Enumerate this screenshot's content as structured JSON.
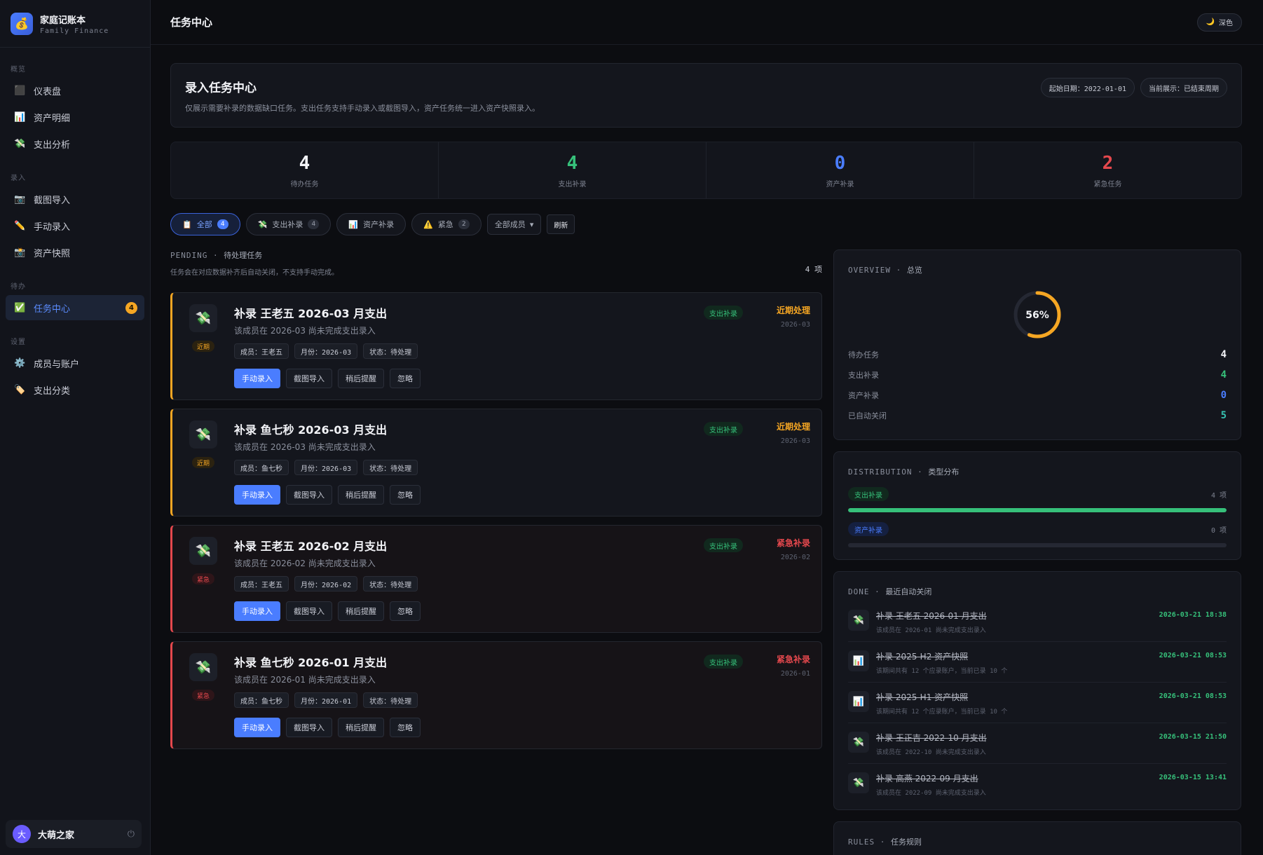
{
  "brand": {
    "title": "家庭记账本",
    "subtitle": "Family Finance",
    "logo": "💰"
  },
  "nav": {
    "sections": [
      {
        "label": "概览",
        "items": [
          {
            "icon": "⬛",
            "label": "仪表盘"
          },
          {
            "icon": "📊",
            "label": "资产明细"
          },
          {
            "icon": "💸",
            "label": "支出分析"
          }
        ]
      },
      {
        "label": "录入",
        "items": [
          {
            "icon": "📷",
            "label": "截图导入"
          },
          {
            "icon": "✏️",
            "label": "手动录入"
          },
          {
            "icon": "📸",
            "label": "资产快照"
          }
        ]
      },
      {
        "label": "待办",
        "items": [
          {
            "icon": "✅",
            "label": "任务中心",
            "badge": "4",
            "active": true
          }
        ]
      },
      {
        "label": "设置",
        "items": [
          {
            "icon": "⚙️",
            "label": "成员与账户"
          },
          {
            "icon": "🏷️",
            "label": "支出分类"
          }
        ]
      }
    ]
  },
  "user": {
    "avatar": "大",
    "name": "大萌之家",
    "power_icon": "⏻"
  },
  "topbar": {
    "title": "任务中心",
    "theme_icon": "🌙",
    "theme_label": "深色"
  },
  "hero": {
    "title": "录入任务中心",
    "desc": "仅展示需要补录的数据缺口任务。支出任务支持手动录入或截图导入，资产任务统一进入资产快照录入。",
    "chip_start": "起始日期：2022-01-01",
    "chip_current": "当前展示：已结束周期"
  },
  "stats": [
    {
      "value": "4",
      "label": "待办任务",
      "color": "#f2f3f7"
    },
    {
      "value": "4",
      "label": "支出补录",
      "color": "#36c07a"
    },
    {
      "value": "0",
      "label": "资产补录",
      "color": "#4a7dff"
    },
    {
      "value": "2",
      "label": "紧急任务",
      "color": "#e5484d"
    }
  ],
  "filters": {
    "all": {
      "icon": "📋",
      "label": "全部",
      "count": "4"
    },
    "expense": {
      "icon": "💸",
      "label": "支出补录",
      "count": "4"
    },
    "asset": {
      "icon": "📊",
      "label": "资产补录"
    },
    "urgent": {
      "icon": "⚠️",
      "label": "紧急",
      "count": "2"
    },
    "member_select": "全部成员",
    "refresh": "刷新"
  },
  "pending": {
    "head_en": "PENDING",
    "head_cn": "待处理任务",
    "sub": "任务会在对应数据补齐后自动关闭，不支持手动完成。",
    "count": "4 项"
  },
  "tasks": [
    {
      "level": "near",
      "tag": "近期",
      "icon": "💸",
      "title": "补录 王老五 2026-03 月支出",
      "desc": "该成员在 2026-03 尚未完成支出录入",
      "meta_member": "成员：王老五",
      "meta_month": "月份：2026-03",
      "meta_status": "状态：待处理",
      "type": "支出补录",
      "status": "近期处理",
      "month": "2026-03"
    },
    {
      "level": "near",
      "tag": "近期",
      "icon": "💸",
      "title": "补录 鱼七秒 2026-03 月支出",
      "desc": "该成员在 2026-03 尚未完成支出录入",
      "meta_member": "成员：鱼七秒",
      "meta_month": "月份：2026-03",
      "meta_status": "状态：待处理",
      "type": "支出补录",
      "status": "近期处理",
      "month": "2026-03"
    },
    {
      "level": "urgent",
      "tag": "紧急",
      "icon": "💸",
      "title": "补录 王老五 2026-02 月支出",
      "desc": "该成员在 2026-02 尚未完成支出录入",
      "meta_member": "成员：王老五",
      "meta_month": "月份：2026-02",
      "meta_status": "状态：待处理",
      "type": "支出补录",
      "status": "紧急补录",
      "month": "2026-02"
    },
    {
      "level": "urgent",
      "tag": "紧急",
      "icon": "💸",
      "title": "补录 鱼七秒 2026-01 月支出",
      "desc": "该成员在 2026-01 尚未完成支出录入",
      "meta_member": "成员：鱼七秒",
      "meta_month": "月份：2026-01",
      "meta_status": "状态：待处理",
      "type": "支出补录",
      "status": "紧急补录",
      "month": "2026-01"
    }
  ],
  "task_actions": {
    "manual": "手动录入",
    "screenshot": "截图导入",
    "later": "稍后提醒",
    "ignore": "忽略"
  },
  "overview": {
    "head_en": "OVERVIEW",
    "head_cn": "总览",
    "percent_label": "56%",
    "progress": 0.56,
    "rows": [
      {
        "label": "待办任务",
        "value": "4",
        "color": "#f2f3f7"
      },
      {
        "label": "支出补录",
        "value": "4",
        "color": "#36c07a"
      },
      {
        "label": "资产补录",
        "value": "0",
        "color": "#4a7dff"
      },
      {
        "label": "已自动关闭",
        "value": "5",
        "color": "#36c0b0"
      }
    ]
  },
  "distribution": {
    "head_en": "DISTRIBUTION",
    "head_cn": "类型分布",
    "items": [
      {
        "label": "支出补录",
        "count": "4 项",
        "fill": 1.0,
        "color": "#36c07a",
        "pill_bg": "#11291e"
      },
      {
        "label": "资产补录",
        "count": "0 项",
        "fill": 0.0,
        "color": "#4a7dff",
        "pill_bg": "#152040"
      }
    ]
  },
  "done": {
    "head_en": "DONE",
    "head_cn": "最近自动关闭",
    "items": [
      {
        "icon": "💸",
        "title": "补录 王老五 2026-01 月支出",
        "desc": "该成员在 2026-01 尚未完成支出录入",
        "time": "2026-03-21 18:38"
      },
      {
        "icon": "📊",
        "title": "补录 2025-H2 资产快照",
        "desc": "该期间共有 12 个应录账户，当前已录 10 个",
        "time": "2026-03-21 08:53"
      },
      {
        "icon": "📊",
        "title": "补录 2025-H1 资产快照",
        "desc": "该期间共有 12 个应录账户，当前已录 10 个",
        "time": "2026-03-21 08:53"
      },
      {
        "icon": "💸",
        "title": "补录 王正吉 2022-10 月支出",
        "desc": "该成员在 2022-10 尚未完成支出录入",
        "time": "2026-03-15 21:50"
      },
      {
        "icon": "💸",
        "title": "补录 高燕 2022-09 月支出",
        "desc": "该成员在 2022-09 尚未完成支出录入",
        "time": "2026-03-15 13:41"
      }
    ]
  },
  "rules": {
    "head_en": "RULES",
    "head_cn": "任务规则"
  }
}
